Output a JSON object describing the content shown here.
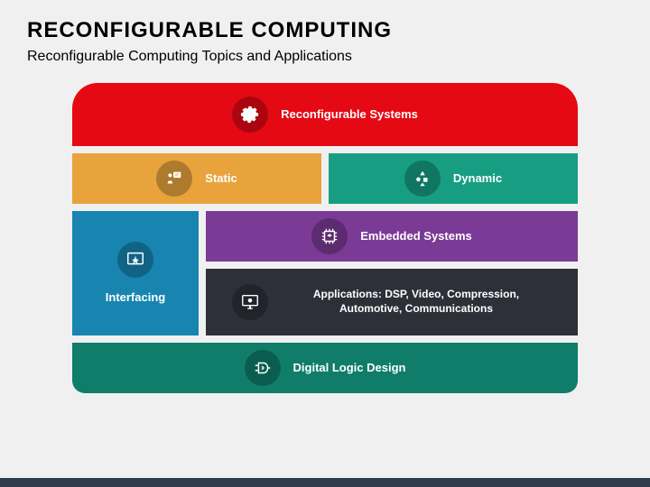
{
  "title": "RECONFIGURABLE COMPUTING",
  "subtitle": "Reconfigurable Computing Topics and Applications",
  "blocks": {
    "top": "Reconfigurable Systems",
    "static": "Static",
    "dynamic": "Dynamic",
    "interfacing": "Interfacing",
    "embedded": "Embedded Systems",
    "apps": "Applications: DSP, Video, Compression, Automotive, Communications",
    "digital": "Digital Logic Design"
  }
}
